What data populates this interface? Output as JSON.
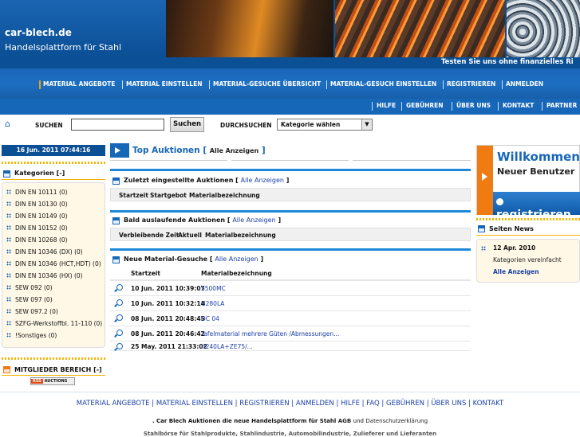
{
  "header": {
    "site_name": "car-blech.de",
    "tagline": "Handelsplattform für Stahl",
    "ticker": "Testen Sie uns ohne finanzielles Ri"
  },
  "nav_main": [
    "MATERIAL ANGEBOTE",
    "MATERIAL EINSTELLEN",
    "MATERIAL-GESUCHE ÜBERSICHT",
    "MATERIAL-GESUCH EINSTELLEN",
    "REGISTRIEREN",
    "ANMELDEN"
  ],
  "nav_sub": [
    "HILFE",
    "GEBÜHREN",
    "ÜBER UNS",
    "KONTAKT",
    "PARTNER"
  ],
  "search": {
    "label": "SUCHEN",
    "button": "Suchen",
    "browse_label": "DURCHSUCHEN",
    "category_select": "Kategorie wählen"
  },
  "date": "16 Jun. 2011 07:44:16",
  "categories": {
    "title": "Kategorien [-]",
    "items": [
      "DIN EN 10111 (0)",
      "DIN EN 10130 (0)",
      "DIN EN 10149 (0)",
      "DIN EN 10152 (0)",
      "DIN EN 10268 (0)",
      "DIN EN 10346 (DX) (0)",
      "DIN EN 10346 (HCT,HDT) (0)",
      "DIN EN 10346 (HX) (0)",
      "SEW 092 (0)",
      "SEW 097 (0)",
      "SEW 097.2 (0)",
      "SZFG-Werkstoffbl. 11-110 (0)",
      "!Sonstiges (0)"
    ]
  },
  "members": {
    "title": "MITGLIEDER BEREICH [-]",
    "badge_left": "RSS",
    "badge_right": "AUCTIONS"
  },
  "top_auctions": {
    "title": "Top Auktionen",
    "link": "Alle Anzeigen"
  },
  "recent": {
    "title": "Zuletzt eingestellte Auktionen",
    "link": "Alle Anzeigen",
    "columns": [
      "Startzeit",
      "Startgebot",
      "Materialbezeichnung"
    ]
  },
  "ending": {
    "title": "Bald auslaufende Auktionen",
    "link": "Alle Anzeigen",
    "columns": [
      "Verbleibende Zeit",
      "Aktuell",
      "Materialbezeichnung"
    ]
  },
  "requests": {
    "title": "Neue Material-Gesuche",
    "link": "Alle Anzeigen",
    "columns": [
      "Startzeit",
      "Materialbezeichnung"
    ],
    "rows": [
      {
        "date": "10 Jun. 2011 10:39:07",
        "material": "S500MC"
      },
      {
        "date": "10 Jun. 2011 10:32:14",
        "material": "H280LA"
      },
      {
        "date": "08 Jun. 2011 20:48:45",
        "material": "DC 04"
      },
      {
        "date": "08 Jun. 2011 20:46:42",
        "material": "Tafelmaterial mehrere Güten /Abmessungen..."
      },
      {
        "date": "25 May. 2011 21:33:02",
        "material": "H240LA+ZE75/..."
      }
    ]
  },
  "welcome": {
    "line1": "Willkommen",
    "line2": "Neuer Benutzer",
    "register": "registrieren"
  },
  "news": {
    "title": "Seiten News",
    "date": "12 Apr. 2010",
    "item": "Kategorien vereinfacht",
    "all": "Alle Anzeigen"
  },
  "footer": {
    "links": [
      "MATERIAL ANGEBOTE",
      "MATERIAL EINSTELLEN",
      "REGISTRIEREN",
      "ANMELDEN",
      "HILFE",
      "FAQ",
      "GEBÜHREN",
      "ÜBER UNS",
      "KONTAKT"
    ],
    "line2_prefix": ". Car Blech Auktionen die neue Handelsplattform für Stahl",
    "agb": "AGB",
    "und": "und",
    "privacy": "Datenschutzerklärung",
    "line3": "Stahlbörse für Stahlprodukte, Stahlindustrie, Automobilindustrie, Zulieferer und Lieferanten"
  }
}
